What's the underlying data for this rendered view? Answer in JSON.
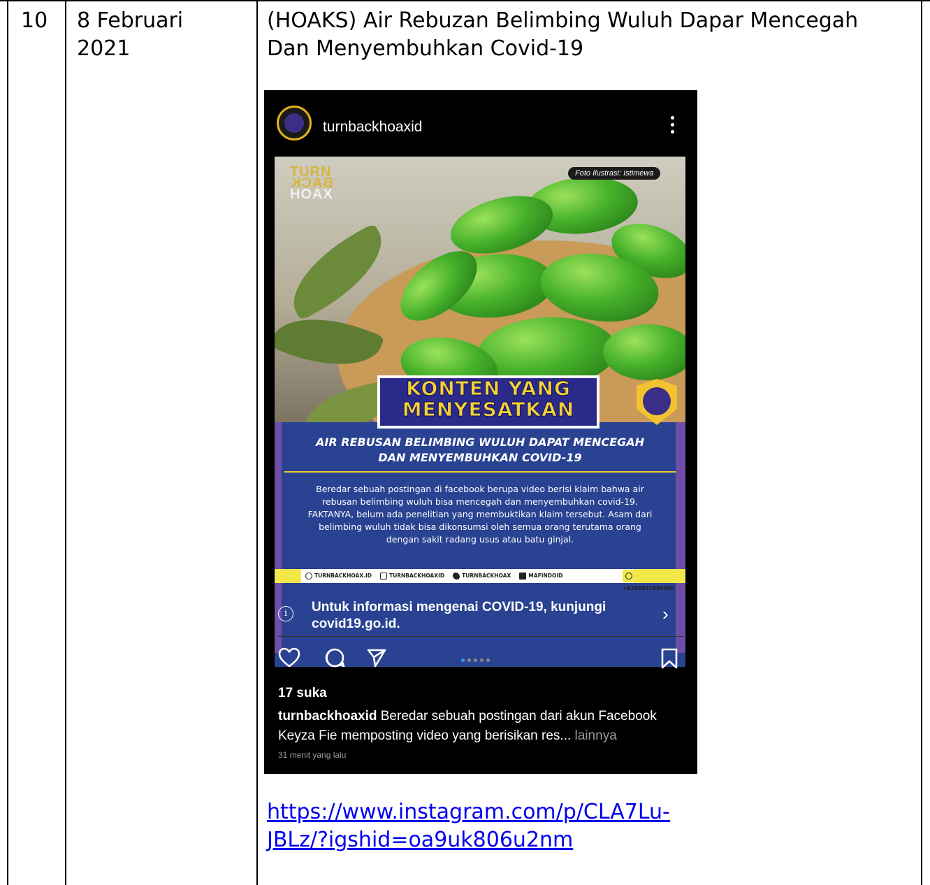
{
  "row": {
    "number": "10",
    "date_line1": "8 Februari",
    "date_line2": "2021",
    "title_line1": "(HOAKS) Air Rebuzan Belimbing Wuluh Dapar Mencegah",
    "title_line2": "Dan Menyembuhkan Covid-19",
    "link_line1": "https://www.instagram.com/p/CLA7Lu-",
    "link_line2": "JBLz/?igshid=oa9uk806u2nm"
  },
  "instagram": {
    "username": "turnbackhoaxid",
    "photo": {
      "logo_line1": "TURN",
      "logo_line2": "BACK",
      "logo_line3": "HOAX",
      "photo_credit": "Foto Ilustrasi: Istimewa",
      "banner_line1": "KONTEN YANG",
      "banner_line2": "MENYESATKAN",
      "headline_line1": "AIR REBUSAN BELIMBING WULUH DAPAT MENCEGAH",
      "headline_line2": "DAN MENYEMBUHKAN COVID-19",
      "body": "Beredar sebuah postingan di facebook berupa video berisi klaim bahwa air rebusan belimbing wuluh bisa mencegah dan menyembuhkan covid-19. FAKTANYA, belum ada penelitian yang membuktikan klaim tersebut. Asam dari belimbing wuluh tidak bisa dikonsumsi oleh semua orang terutama orang dengan sakit radang usus atau batu ginjal.",
      "social_web": "TURNBACKHOAX.ID",
      "social_instagram": "TURNBACKHOAXID",
      "social_twitter": "TURNBACKHOAX",
      "social_facebook": "MAFINDOID",
      "social_whatsapp": "+6285921600500"
    },
    "covid_notice": "Untuk informasi mengenai COVID-19, kunjungi covid19.go.id.",
    "likes": "17 suka",
    "caption_user": "turnbackhoaxid",
    "caption_text": " Beredar sebuah postingan dari akun Facebook Keyza Fie memposting video yang berisikan res",
    "caption_ellipsis": "...",
    "caption_more": " lainnya",
    "timestamp": "31 menit yang lalu",
    "carousel_active_index": 1,
    "carousel_count": 5
  },
  "colors": {
    "link": "#0000EE",
    "banner_bg": "#2b2a8a",
    "banner_text": "#f2d238",
    "card_bg": "#2a4292",
    "accent_yellow": "#f0cf2d"
  }
}
